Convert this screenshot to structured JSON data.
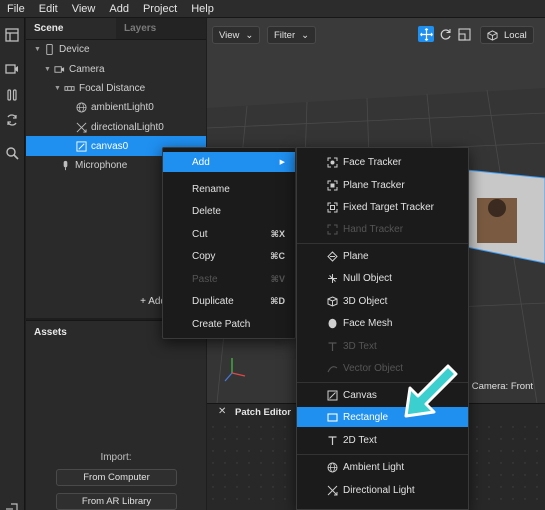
{
  "menubar": {
    "items": [
      "File",
      "Edit",
      "View",
      "Add",
      "Project",
      "Help"
    ]
  },
  "toolbar": {
    "icons": [
      "layout-icon",
      "video-icon",
      "pause-icon",
      "sync-icon",
      "search-icon",
      "exit-icon"
    ]
  },
  "scene": {
    "tabs": [
      "Scene",
      "Layers"
    ],
    "tree": [
      {
        "label": "Device",
        "icon": "phone-icon"
      },
      {
        "label": "Camera",
        "icon": "camera-icon"
      },
      {
        "label": "Focal Distance",
        "icon": "focal-icon"
      },
      {
        "label": "ambientLight0",
        "icon": "globe-icon"
      },
      {
        "label": "directionalLight0",
        "icon": "arrows-icon"
      },
      {
        "label": "canvas0",
        "icon": "canvas-icon"
      },
      {
        "label": "Microphone",
        "icon": "mic-icon"
      }
    ],
    "add_label": "+ Add"
  },
  "assets": {
    "title": "Assets",
    "import_label": "Import:",
    "from_computer": "From Computer",
    "from_ar_library": "From AR Library"
  },
  "viewport": {
    "view_label": "View",
    "filter_label": "Filter",
    "local_label": "Local",
    "camera_label": "Camera: Front"
  },
  "patch_editor": {
    "title": "Patch Editor",
    "close": "✕"
  },
  "context_menu": {
    "items": [
      {
        "label": "Add",
        "shortcut": "▶",
        "state": "highlighted"
      },
      {
        "label": "Rename",
        "shortcut": "",
        "state": "normal"
      },
      {
        "label": "Delete",
        "shortcut": "",
        "state": "normal"
      },
      {
        "label": "Cut",
        "shortcut": "⌘X",
        "state": "normal"
      },
      {
        "label": "Copy",
        "shortcut": "⌘C",
        "state": "normal"
      },
      {
        "label": "Paste",
        "shortcut": "⌘V",
        "state": "disabled"
      },
      {
        "label": "Duplicate",
        "shortcut": "⌘D",
        "state": "normal"
      },
      {
        "label": "Create Patch",
        "shortcut": "",
        "state": "normal"
      }
    ]
  },
  "add_submenu": {
    "items": [
      {
        "label": "Face Tracker",
        "icon": "tracker-icon",
        "state": "normal"
      },
      {
        "label": "Plane Tracker",
        "icon": "tracker-icon",
        "state": "normal"
      },
      {
        "label": "Fixed Target Tracker",
        "icon": "tracker-icon",
        "state": "normal"
      },
      {
        "label": "Hand Tracker",
        "icon": "tracker-icon",
        "state": "disabled"
      },
      {
        "label": "Plane",
        "icon": "plane-icon",
        "state": "normal"
      },
      {
        "label": "Null Object",
        "icon": "null-icon",
        "state": "normal"
      },
      {
        "label": "3D Object",
        "icon": "cube-icon",
        "state": "normal"
      },
      {
        "label": "Face Mesh",
        "icon": "face-icon",
        "state": "normal"
      },
      {
        "label": "3D Text",
        "icon": "text-icon",
        "state": "disabled"
      },
      {
        "label": "Vector Object",
        "icon": "vector-icon",
        "state": "disabled"
      },
      {
        "label": "Canvas",
        "icon": "canvas-icon",
        "state": "normal"
      },
      {
        "label": "Rectangle",
        "icon": "rectangle-icon",
        "state": "highlighted"
      },
      {
        "label": "2D Text",
        "icon": "text-icon",
        "state": "normal"
      },
      {
        "label": "Ambient Light",
        "icon": "globe-icon",
        "state": "normal"
      },
      {
        "label": "Directional Light",
        "icon": "arrows-icon",
        "state": "normal"
      }
    ]
  },
  "colors": {
    "accent": "#1f8ff0",
    "pointer": "#3ccfcf"
  }
}
